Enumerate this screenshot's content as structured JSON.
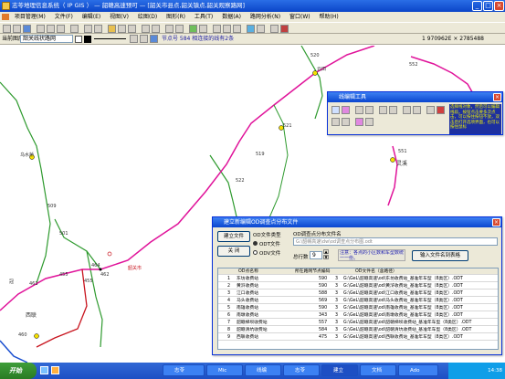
{
  "window": {
    "title": "志苓地理信息系统（ IP GIS ） — 韶赣高速预可 — [韶关市县点,韶关镇点,韶关观察路网]"
  },
  "menu": [
    "项目管理(M)",
    "文件(F)",
    "编辑(E)",
    "视图(V)",
    "绘图(D)",
    "图形(R)",
    "工具(T)",
    "数据(A)",
    "路网分析(N)",
    "窗口(W)",
    "帮助(H)"
  ],
  "status": {
    "current_label": "当前图层",
    "layer_value": "韶关线状路网",
    "info": "节点号 584  相连接的线有2条",
    "coords": "1  970962E  × 2785488"
  },
  "map": {
    "labels": {
      "yundan": "云田",
      "n520": "520",
      "n552": "552",
      "n551": "551",
      "lingxi": "灵溪",
      "n519": "519",
      "n522": "522",
      "n521": "521",
      "n509": "509",
      "n501": "501",
      "wushuiqiao": "乌水桥",
      "n464": "464",
      "n462": "462",
      "n455": "455",
      "n455b": "455",
      "shaoguan": "韶关市",
      "xilian": "西联",
      "n461": "461",
      "n460": "460",
      "n_n": "冠"
    }
  },
  "lineedit": {
    "title": "线编辑工具",
    "hint": "选择线对象，然后可以编辑线段。按钮点击要多次点击，可以按住按钮不放，双击后打开选项界面，也可以按住鼠标"
  },
  "od": {
    "title": "建立新编辑OD调查点分布文件",
    "create_button": "建立文件",
    "close_button": "关 闭",
    "type_label": "OD文件类型",
    "options": [
      "ODT文件",
      "ODV文件"
    ],
    "name_label": "OD调查点分布文件名",
    "name_value": "G:\\韶赣高速\\dw\\od调查点分布图.odt",
    "rows_label": "总行数",
    "rows_value": "9",
    "note": "注意：各点的小区数和车型数统一一份。",
    "import_button": "输入文件名到表格",
    "columns": [
      "OD点名称",
      "所在路网节点编码",
      "OD文件名（含路径）"
    ],
    "rows": [
      [
        "1",
        "东坊收费站",
        "590",
        "3",
        "G:\\GeL\\韶赣高速\\od\\东坊收费站_基准年车型（8类区）.ODT"
      ],
      [
        "2",
        "黄浒收费站",
        "590",
        "3",
        "G:\\GeL\\韶赣高速\\od\\黄浒收费站_基准年车型（8类区）.ODT"
      ],
      [
        "3",
        "江口收费站",
        "588",
        "3",
        "G:\\GeL\\韶赣高速\\od\\江口收费站_基准年车型（8类区）.ODT"
      ],
      [
        "4",
        "马头收费站",
        "569",
        "3",
        "G:\\GeL\\韶赣高速\\od\\马头收费站_基准年车型（8类区）.ODT"
      ],
      [
        "5",
        "南雄收费站",
        "590",
        "3",
        "G:\\GeL\\韶赣高速\\od\\南雄收费站_基准年车型（8类区）.ODT"
      ],
      [
        "6",
        "南墩收费站",
        "343",
        "3",
        "G:\\GeL\\韶赣高速\\od\\南墩收费站_基准年车型（8类区）.ODT"
      ],
      [
        "7",
        "韶赣梯坝收费站",
        "557",
        "3",
        "G:\\GeL\\韶赣高速\\od\\韶赣梯坝收费站_基准年车型（8类区）.ODT"
      ],
      [
        "8",
        "韶赣清坑收费站",
        "584",
        "3",
        "G:\\GeL\\韶赣高速\\od\\韶赣清坑收费站_基准年车型（8类区）.ODT"
      ],
      [
        "9",
        "西联收费站",
        "475",
        "3",
        "G:\\GeL\\韶赣高速\\od\\西联收费站_基准年车型（8类区）.ODT"
      ]
    ]
  },
  "taskbar": {
    "start": "开始",
    "tasks": [
      "志苓",
      "Mic",
      "线编",
      "志苓",
      "建立",
      "文档",
      "Ado"
    ],
    "time": "14:38"
  }
}
